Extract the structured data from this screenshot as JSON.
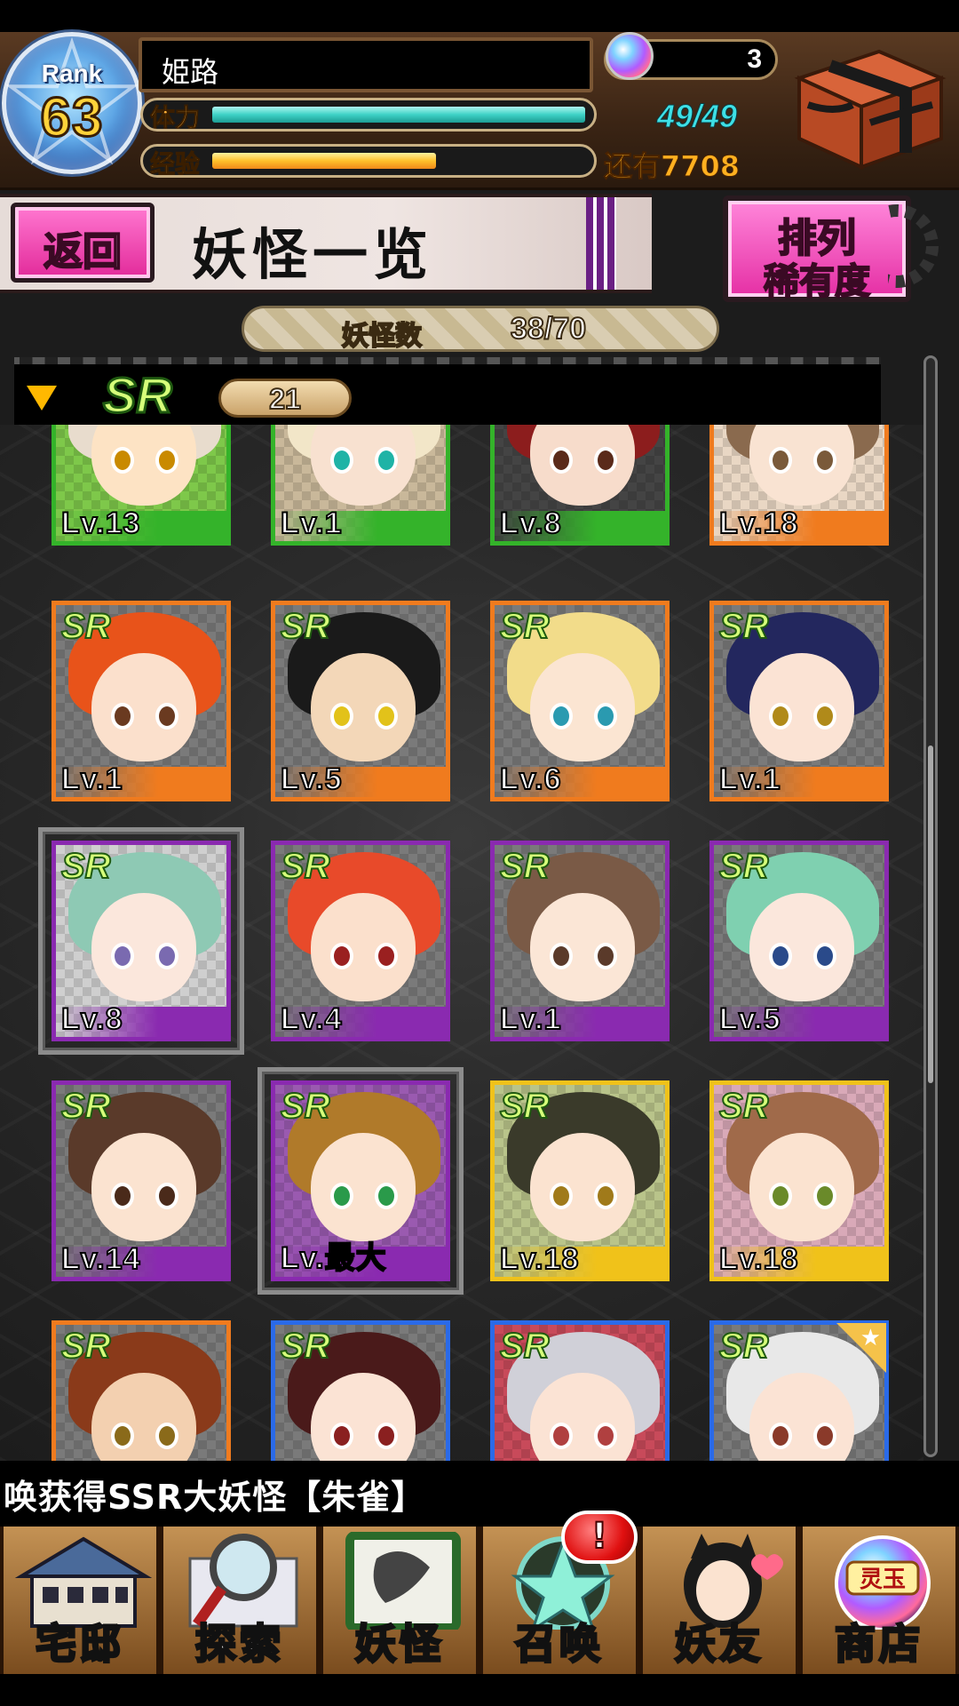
{
  "header": {
    "rank_label": "Rank",
    "rank_value": "63",
    "player_name": "姫路",
    "stamina_label": "体力",
    "stamina_value": "49/49",
    "stamina_fraction": 1.0,
    "exp_label": "经验",
    "exp_fraction": 0.6,
    "exp_remaining": "还有7708",
    "gem_count": "3"
  },
  "title_bar": {
    "back_label": "返回",
    "page_title": "妖怪一览",
    "sort_label_line1": "排列",
    "sort_label_line2": "稀有度"
  },
  "count_bar": {
    "label": "妖怪数",
    "value": "38/70"
  },
  "group": {
    "rarity": "SR",
    "count": "21"
  },
  "cards": [
    {
      "rarity": "",
      "level": "Lv.13",
      "frame": "green",
      "hair": "#e8dccd",
      "skin": "#fde3c4",
      "eye": "#c98a00",
      "bg": "#7ec84a"
    },
    {
      "rarity": "",
      "level": "Lv.1",
      "frame": "green",
      "hair": "#f2e6c8",
      "skin": "#f8e1d0",
      "eye": "#1fb3a6",
      "bg": "#c9b89a"
    },
    {
      "rarity": "",
      "level": "Lv.8",
      "frame": "green",
      "hair": "#8c1d1d",
      "skin": "#f7dccb",
      "eye": "#5a2a1a",
      "bg": "#444"
    },
    {
      "rarity": "",
      "level": "Lv.18",
      "frame": "orange",
      "hair": "#8a6a4e",
      "skin": "#f9e3d2",
      "eye": "#7a5a3a",
      "bg": "#e9d7c4"
    },
    {
      "rarity": "SR",
      "level": "Lv.1",
      "frame": "orange",
      "hair": "#e8531a",
      "skin": "#fbe0cc",
      "eye": "#6a3a20",
      "bg": "#7a7a7a"
    },
    {
      "rarity": "SR",
      "level": "Lv.5",
      "frame": "orange",
      "hair": "#1a1a1a",
      "skin": "#f3d7b8",
      "eye": "#e2c21a",
      "bg": "#7a7a7a"
    },
    {
      "rarity": "SR",
      "level": "Lv.6",
      "frame": "orange",
      "hair": "#f2dc8a",
      "skin": "#fbe5d2",
      "eye": "#2a9ab0",
      "bg": "#7a7a7a"
    },
    {
      "rarity": "SR",
      "level": "Lv.1",
      "frame": "orange",
      "hair": "#23275e",
      "skin": "#fbe3d4",
      "eye": "#b08a1a",
      "bg": "#7a7a7a"
    },
    {
      "rarity": "SR",
      "level": "Lv.8",
      "frame": "purple",
      "hair": "#8ec9b4",
      "skin": "#fbe7dc",
      "eye": "#7a6ab0",
      "bg": "#cfcfcf",
      "selected": true
    },
    {
      "rarity": "SR",
      "level": "Lv.4",
      "frame": "purple",
      "hair": "#e84a2a",
      "skin": "#fbe0cc",
      "eye": "#9a2020",
      "bg": "#7a7a7a"
    },
    {
      "rarity": "SR",
      "level": "Lv.1",
      "frame": "purple",
      "hair": "#7a5a46",
      "skin": "#fbe6d6",
      "eye": "#5a3a2a",
      "bg": "#7a7a7a"
    },
    {
      "rarity": "SR",
      "level": "Lv.5",
      "frame": "purple",
      "hair": "#7fd0b0",
      "skin": "#fbe7dc",
      "eye": "#2a4a8a",
      "bg": "#7a7a7a"
    },
    {
      "rarity": "SR",
      "level": "Lv.14",
      "frame": "purple",
      "hair": "#5a3a2a",
      "skin": "#fbe3d0",
      "eye": "#4a2a1a",
      "bg": "#7a7a7a"
    },
    {
      "rarity": "SR",
      "level": "Lv.最大",
      "frame": "purple",
      "hair": "#b07a2a",
      "skin": "#fbe3d0",
      "eye": "#2a9a4a",
      "bg": "#9a5ab0",
      "selected": true
    },
    {
      "rarity": "SR",
      "level": "Lv.18",
      "frame": "yellow",
      "hair": "#3a3a2a",
      "skin": "#fbe3d0",
      "eye": "#a07a1a",
      "bg": "#b9c48a"
    },
    {
      "rarity": "SR",
      "level": "Lv.18",
      "frame": "yellow",
      "hair": "#a06a4a",
      "skin": "#fbe3d0",
      "eye": "#6a8a2a",
      "bg": "#d9a9b8"
    },
    {
      "rarity": "SR",
      "level": "",
      "frame": "orange",
      "hair": "#8a3a1a",
      "skin": "#f3d0b0",
      "eye": "#8a6a1a",
      "bg": "#7a7a7a"
    },
    {
      "rarity": "SR",
      "level": "",
      "frame": "blue",
      "hair": "#4a1a1a",
      "skin": "#fbe3d4",
      "eye": "#8a2020",
      "bg": "#7a7a7a"
    },
    {
      "rarity": "SR",
      "level": "",
      "frame": "blue",
      "hair": "#d0d0d8",
      "skin": "#fbe3d4",
      "eye": "#b04040",
      "bg": "#c84a5a"
    },
    {
      "rarity": "SR",
      "level": "",
      "frame": "blue",
      "hair": "#e8e8e8",
      "skin": "#fbe3d4",
      "eye": "#8a3a2a",
      "bg": "#7a7a7a",
      "star": true
    }
  ],
  "ticker": {
    "text": "唤获得SSR大妖怪【朱雀】"
  },
  "bottom_nav": {
    "items": [
      {
        "label": "宅邸",
        "icon": "mansion-icon"
      },
      {
        "label": "探索",
        "icon": "magnifier-map-icon"
      },
      {
        "label": "妖怪",
        "icon": "scroll-icon"
      },
      {
        "label": "召唤",
        "icon": "pentagram-icon"
      },
      {
        "label": "妖友",
        "icon": "catgirl-friend-icon"
      },
      {
        "label": "商店",
        "icon": "spirit-orb-icon"
      }
    ],
    "alert": "!",
    "orb_label": "灵玉"
  },
  "colors": {
    "frame_green": "#34b32a",
    "frame_orange": "#f07b1e",
    "frame_purple": "#8a2ab0",
    "frame_yellow": "#f0c21a",
    "frame_blue": "#2a6ae8",
    "accent_pink": "#e22a9a",
    "stamina": "#3ed2c6",
    "exp": "#ffc12b"
  }
}
